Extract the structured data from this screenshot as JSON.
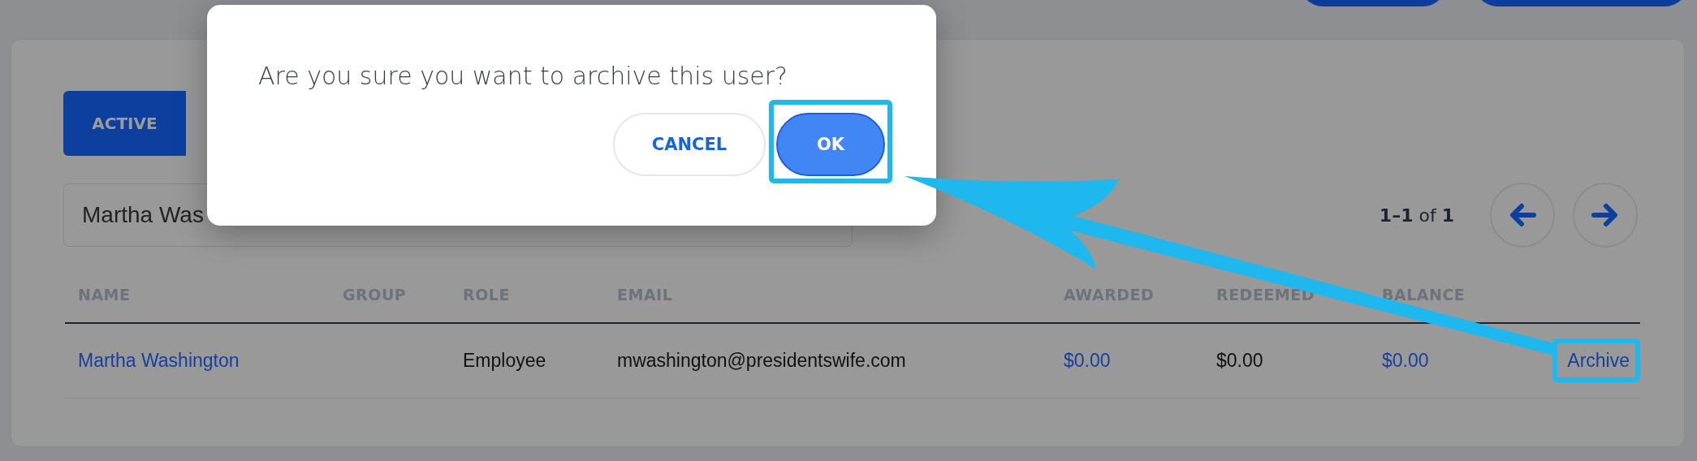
{
  "tabs": [
    {
      "label": "ACTIVE",
      "selected": true
    }
  ],
  "search": {
    "value": "Martha Was"
  },
  "pagination": {
    "range": "**1–1** of **1**"
  },
  "table": {
    "columns": [
      "NAME",
      "GROUP",
      "ROLE",
      "EMAIL",
      "AWARDED",
      "REDEEMED",
      "BALANCE"
    ],
    "rows": [
      {
        "name": "Martha Washington",
        "group": "",
        "role": "Employee",
        "email": "mwashington@presidentswife.com",
        "awarded": "$0.00",
        "redeemed": "$0.00",
        "balance": "$0.00",
        "action": "Archive"
      }
    ]
  },
  "dialog": {
    "message": "Are you sure you want to archive this user?",
    "buttons": [
      {
        "label": "CANCEL",
        "kind": "secondary"
      },
      {
        "label": "OK",
        "kind": "primary"
      }
    ]
  }
}
